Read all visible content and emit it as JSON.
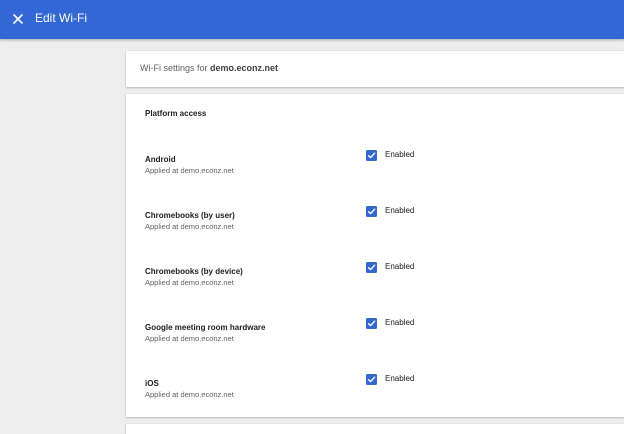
{
  "appbar": {
    "title": "Edit Wi-Fi",
    "close_icon": "close-icon",
    "background_color": "#3367d6"
  },
  "header_card": {
    "prefix": "Wi-Fi settings for ",
    "domain": "demo.econz.net"
  },
  "platform_access": {
    "title": "Platform access",
    "checkbox_color": "#3367d6",
    "rows": [
      {
        "name": "Android",
        "applied": "Applied at demo.econz.net",
        "enabled_label": "Enabled",
        "checked": true
      },
      {
        "name": "Chromebooks (by user)",
        "applied": "Applied at demo.econz.net",
        "enabled_label": "Enabled",
        "checked": true
      },
      {
        "name": "Chromebooks (by device)",
        "applied": "Applied at demo.econz.net",
        "enabled_label": "Enabled",
        "checked": true
      },
      {
        "name": "Google meeting room hardware",
        "applied": "Applied at demo.econz.net",
        "enabled_label": "Enabled",
        "checked": true
      },
      {
        "name": "iOS",
        "applied": "Applied at demo.econz.net",
        "enabled_label": "Enabled",
        "checked": true
      }
    ]
  }
}
